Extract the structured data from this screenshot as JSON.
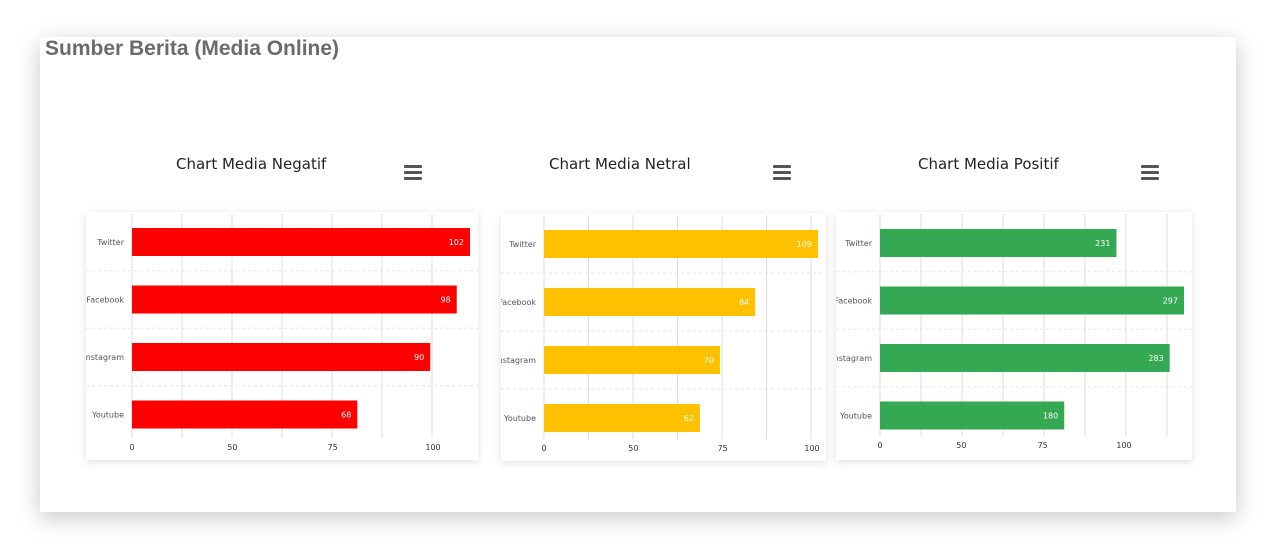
{
  "section_title": "Sumber Berita (Media Online)",
  "menu_icon": "hamburger-menu-icon",
  "chart_data": [
    {
      "type": "bar",
      "orientation": "horizontal",
      "title": "Chart Media Negatif",
      "color": "#ff0000",
      "categories": [
        "Twitter",
        "Facebook",
        "Instagram",
        "Youtube"
      ],
      "values": [
        102,
        98,
        90,
        68
      ],
      "xticks": [
        "0",
        "50",
        "75",
        "100"
      ]
    },
    {
      "type": "bar",
      "orientation": "horizontal",
      "title": "Chart Media Netral",
      "color": "#ffc000",
      "categories": [
        "Twitter",
        "Facebook",
        "Instagram",
        "Youtube"
      ],
      "values": [
        109,
        84,
        70,
        62
      ],
      "xticks": [
        "0",
        "50",
        "75",
        "100"
      ]
    },
    {
      "type": "bar",
      "orientation": "horizontal",
      "title": "Chart Media Positif",
      "color": "#35a853",
      "categories": [
        "Twitter",
        "Facebook",
        "Instagram",
        "Youtube"
      ],
      "values": [
        231,
        297,
        283,
        180
      ],
      "xticks": [
        "0",
        "50",
        "75",
        "100"
      ]
    }
  ]
}
